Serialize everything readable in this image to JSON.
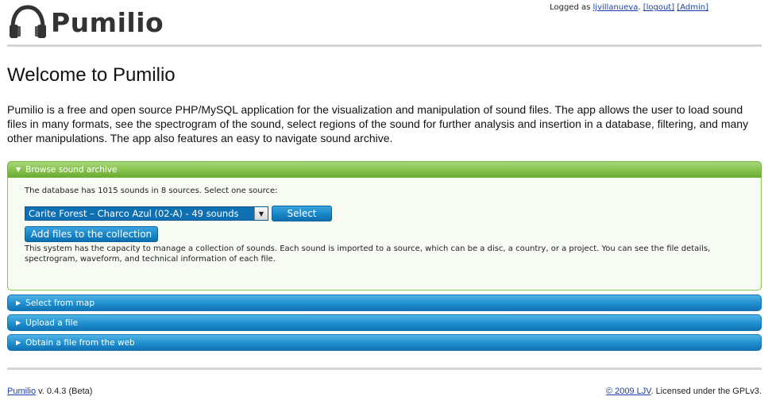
{
  "header": {
    "logo_text": "Pumilio",
    "logo_icon": "headphones-icon",
    "logged_as_label": "Logged as",
    "username": "ljvillanueva",
    "logout_link": "[logout]",
    "admin_link": "[Admin]"
  },
  "main": {
    "title": "Welcome to Pumilio",
    "intro": "Pumilio is a free and open source PHP/MySQL application for the visualization and manipulation of sound files. The app allows the user to load sound files in many formats, see the spectrogram of the sound, select regions of the sound for further analysis and insertion in a database, filtering, and many other manipulations. The app also features an easy to navigate sound archive."
  },
  "browse": {
    "header_label": "Browse sound archive",
    "db_text": "The database has 1015 sounds in 8 sources. Select one source:",
    "source_selected": "Carite Forest – Charco Azul (02-A) - 49 sounds",
    "select_button": "Select",
    "add_files_button": "Add files to the collection",
    "capacity_text": "This system has the capacity to manage a collection of sounds. Each sound is imported to a source, which can be a disc, a country, or a project. You can see the file details, spectrogram, waveform, and technical information of each file."
  },
  "sections": [
    {
      "label": "Select from map"
    },
    {
      "label": "Upload a file"
    },
    {
      "label": "Obtain a file from the web"
    }
  ],
  "footer": {
    "app_link": "Pumilio",
    "version": " v. 0.4.3 (Beta)",
    "copyright_link": "© 2009 LJV",
    "license": ". Licensed under the GPLv3."
  },
  "colors": {
    "accordion_active": "#86c24d",
    "accordion_inactive": "#1f8fcf",
    "link": "#1a3fa8"
  }
}
